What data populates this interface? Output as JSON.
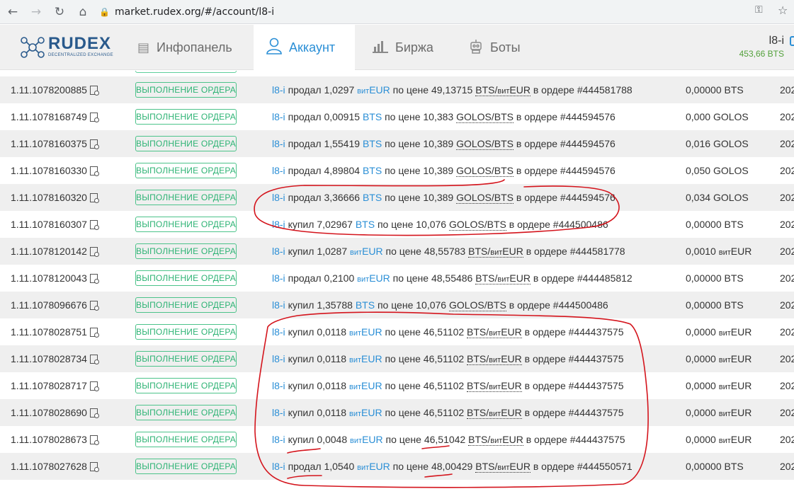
{
  "browser": {
    "url": "market.rudex.org/#/account/l8-i",
    "back_icon": "arrow-left-icon",
    "forward_icon": "arrow-right-icon",
    "reload_icon": "reload-icon",
    "home_icon": "home-icon"
  },
  "header": {
    "logo": {
      "word": "RUDEX",
      "sub": "DECENTRALIZED EXCHANGE"
    },
    "nav": [
      {
        "label": "Инфопанель",
        "icon": "dashboard-icon",
        "active": false
      },
      {
        "label": "Аккаунт",
        "icon": "user-icon",
        "active": true
      },
      {
        "label": "Биржа",
        "icon": "chart-bars-icon",
        "active": false
      },
      {
        "label": "Боты",
        "icon": "robot-icon",
        "active": false
      }
    ],
    "account": {
      "name": "l8-i",
      "balance": "453,66 BTS"
    }
  },
  "colors": {
    "accent": "#2b8fd6",
    "badge": "#2db374",
    "annotation": "#d4141c",
    "balance": "#53a13b"
  },
  "rows": [
    {
      "id": "1.11.1078200885",
      "status": "ВЫПОЛНЕНИЕ ОРДЕРА",
      "account": "l8-i",
      "action": "продал",
      "amount": "1,0297",
      "asset_prefix": "вит",
      "asset": "EUR",
      "price_text": "по цене",
      "price": "49,13715",
      "pair_base": "BTS/",
      "pair_prefix": "вит",
      "pair_quote": "EUR",
      "order_text": "в ордере #444581788",
      "fee_value": "0,00000",
      "fee_prefix": "",
      "fee_asset": "BTS",
      "date": "202"
    },
    {
      "id": "1.11.1078168749",
      "status": "ВЫПОЛНЕНИЕ ОРДЕРА",
      "account": "l8-i",
      "action": "продал",
      "amount": "0,00915",
      "asset_prefix": "",
      "asset": "BTS",
      "price_text": "по цене",
      "price": "10,383",
      "pair_base": "GOLOS/",
      "pair_prefix": "",
      "pair_quote": "BTS",
      "order_text": "в ордере #444594576",
      "fee_value": "0,000",
      "fee_prefix": "",
      "fee_asset": "GOLOS",
      "date": "202"
    },
    {
      "id": "1.11.1078160375",
      "status": "ВЫПОЛНЕНИЕ ОРДЕРА",
      "account": "l8-i",
      "action": "продал",
      "amount": "1,55419",
      "asset_prefix": "",
      "asset": "BTS",
      "price_text": "по цене",
      "price": "10,389",
      "pair_base": "GOLOS/",
      "pair_prefix": "",
      "pair_quote": "BTS",
      "order_text": "в ордере #444594576",
      "fee_value": "0,016",
      "fee_prefix": "",
      "fee_asset": "GOLOS",
      "date": "202"
    },
    {
      "id": "1.11.1078160330",
      "status": "ВЫПОЛНЕНИЕ ОРДЕРА",
      "account": "l8-i",
      "action": "продал",
      "amount": "4,89804",
      "asset_prefix": "",
      "asset": "BTS",
      "price_text": "по цене",
      "price": "10,389",
      "pair_base": "GOLOS/",
      "pair_prefix": "",
      "pair_quote": "BTS",
      "order_text": "в ордере #444594576",
      "fee_value": "0,050",
      "fee_prefix": "",
      "fee_asset": "GOLOS",
      "date": "202"
    },
    {
      "id": "1.11.1078160320",
      "status": "ВЫПОЛНЕНИЕ ОРДЕРА",
      "account": "l8-i",
      "action": "продал",
      "amount": "3,36666",
      "asset_prefix": "",
      "asset": "BTS",
      "price_text": "по цене",
      "price": "10,389",
      "pair_base": "GOLOS/",
      "pair_prefix": "",
      "pair_quote": "BTS",
      "order_text": "в ордере #444594576",
      "fee_value": "0,034",
      "fee_prefix": "",
      "fee_asset": "GOLOS",
      "date": "202"
    },
    {
      "id": "1.11.1078160307",
      "status": "ВЫПОЛНЕНИЕ ОРДЕРА",
      "account": "l8-i",
      "action": "купил",
      "amount": "7,02967",
      "asset_prefix": "",
      "asset": "BTS",
      "price_text": "по цене",
      "price": "10,076",
      "pair_base": "GOLOS/",
      "pair_prefix": "",
      "pair_quote": "BTS",
      "order_text": "в ордере #444500486",
      "fee_value": "0,00000",
      "fee_prefix": "",
      "fee_asset": "BTS",
      "date": "202"
    },
    {
      "id": "1.11.1078120142",
      "status": "ВЫПОЛНЕНИЕ ОРДЕРА",
      "account": "l8-i",
      "action": "купил",
      "amount": "1,0287",
      "asset_prefix": "вит",
      "asset": "EUR",
      "price_text": "по цене",
      "price": "48,55783",
      "pair_base": "BTS/",
      "pair_prefix": "вит",
      "pair_quote": "EUR",
      "order_text": "в ордере #444581778",
      "fee_value": "0,0010",
      "fee_prefix": "вит",
      "fee_asset": "EUR",
      "date": "202"
    },
    {
      "id": "1.11.1078120043",
      "status": "ВЫПОЛНЕНИЕ ОРДЕРА",
      "account": "l8-i",
      "action": "продал",
      "amount": "0,2100",
      "asset_prefix": "вит",
      "asset": "EUR",
      "price_text": "по цене",
      "price": "48,55486",
      "pair_base": "BTS/",
      "pair_prefix": "вит",
      "pair_quote": "EUR",
      "order_text": "в ордере #444485812",
      "fee_value": "0,00000",
      "fee_prefix": "",
      "fee_asset": "BTS",
      "date": "202"
    },
    {
      "id": "1.11.1078096676",
      "status": "ВЫПОЛНЕНИЕ ОРДЕРА",
      "account": "l8-i",
      "action": "купил",
      "amount": "1,35788",
      "asset_prefix": "",
      "asset": "BTS",
      "price_text": "по цене",
      "price": "10,076",
      "pair_base": "GOLOS/",
      "pair_prefix": "",
      "pair_quote": "BTS",
      "order_text": "в ордере #444500486",
      "fee_value": "0,00000",
      "fee_prefix": "",
      "fee_asset": "BTS",
      "date": "202"
    },
    {
      "id": "1.11.1078028751",
      "status": "ВЫПОЛНЕНИЕ ОРДЕРА",
      "account": "l8-i",
      "action": "купил",
      "amount": "0,0118",
      "asset_prefix": "вит",
      "asset": "EUR",
      "price_text": "по цене",
      "price": "46,51102",
      "pair_base": "BTS/",
      "pair_prefix": "вит",
      "pair_quote": "EUR",
      "order_text": "в ордере #444437575",
      "fee_value": "0,0000",
      "fee_prefix": "вит",
      "fee_asset": "EUR",
      "date": "202"
    },
    {
      "id": "1.11.1078028734",
      "status": "ВЫПОЛНЕНИЕ ОРДЕРА",
      "account": "l8-i",
      "action": "купил",
      "amount": "0,0118",
      "asset_prefix": "вит",
      "asset": "EUR",
      "price_text": "по цене",
      "price": "46,51102",
      "pair_base": "BTS/",
      "pair_prefix": "вит",
      "pair_quote": "EUR",
      "order_text": "в ордере #444437575",
      "fee_value": "0,0000",
      "fee_prefix": "вит",
      "fee_asset": "EUR",
      "date": "202"
    },
    {
      "id": "1.11.1078028717",
      "status": "ВЫПОЛНЕНИЕ ОРДЕРА",
      "account": "l8-i",
      "action": "купил",
      "amount": "0,0118",
      "asset_prefix": "вит",
      "asset": "EUR",
      "price_text": "по цене",
      "price": "46,51102",
      "pair_base": "BTS/",
      "pair_prefix": "вит",
      "pair_quote": "EUR",
      "order_text": "в ордере #444437575",
      "fee_value": "0,0000",
      "fee_prefix": "вит",
      "fee_asset": "EUR",
      "date": "202"
    },
    {
      "id": "1.11.1078028690",
      "status": "ВЫПОЛНЕНИЕ ОРДЕРА",
      "account": "l8-i",
      "action": "купил",
      "amount": "0,0118",
      "asset_prefix": "вит",
      "asset": "EUR",
      "price_text": "по цене",
      "price": "46,51102",
      "pair_base": "BTS/",
      "pair_prefix": "вит",
      "pair_quote": "EUR",
      "order_text": "в ордере #444437575",
      "fee_value": "0,0000",
      "fee_prefix": "вит",
      "fee_asset": "EUR",
      "date": "202"
    },
    {
      "id": "1.11.1078028673",
      "status": "ВЫПОЛНЕНИЕ ОРДЕРА",
      "account": "l8-i",
      "action": "купил",
      "amount": "0,0048",
      "asset_prefix": "вит",
      "asset": "EUR",
      "price_text": "по цене",
      "price": "46,51042",
      "pair_base": "BTS/",
      "pair_prefix": "вит",
      "pair_quote": "EUR",
      "order_text": "в ордере #444437575",
      "fee_value": "0,0000",
      "fee_prefix": "вит",
      "fee_asset": "EUR",
      "date": "202"
    },
    {
      "id": "1.11.1078027628",
      "status": "ВЫПОЛНЕНИЕ ОРДЕРА",
      "account": "l8-i",
      "action": "продал",
      "amount": "1,0540",
      "asset_prefix": "вит",
      "asset": "EUR",
      "price_text": "по цене",
      "price": "48,00429",
      "pair_base": "BTS/",
      "pair_prefix": "вит",
      "pair_quote": "EUR",
      "order_text": "в ордере #444550571",
      "fee_value": "0,00000",
      "fee_prefix": "",
      "fee_asset": "BTS",
      "date": "202"
    }
  ]
}
